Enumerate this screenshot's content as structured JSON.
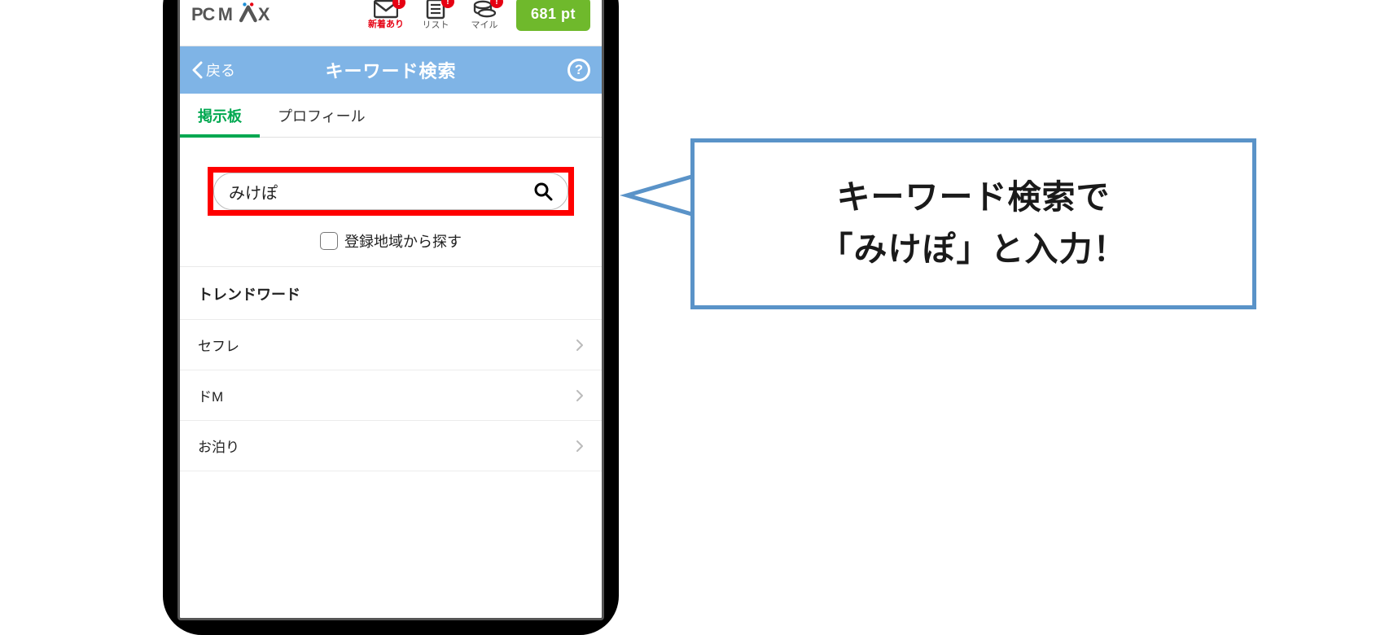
{
  "header": {
    "logo_text": "PCMAX",
    "icons": [
      {
        "name": "mail-icon",
        "label": "新着あり",
        "badge": "!"
      },
      {
        "name": "list-icon",
        "label": "リスト",
        "badge": "!"
      },
      {
        "name": "coins-icon",
        "label": "マイル",
        "badge": "!"
      }
    ],
    "points_button": "681 pt"
  },
  "navbar": {
    "back_label": "戻る",
    "title": "キーワード検索",
    "help_label": "?"
  },
  "tabs": {
    "items": [
      {
        "label": "掲示板",
        "active": true
      },
      {
        "label": "プロフィール",
        "active": false
      }
    ]
  },
  "search": {
    "value": "みけぽ",
    "region_checkbox_label": "登録地域から探す",
    "region_checked": false
  },
  "trend": {
    "header": "トレンドワード",
    "items": [
      {
        "label": "セフレ"
      },
      {
        "label": "ドM"
      },
      {
        "label": "お泊り"
      }
    ]
  },
  "callout": {
    "line1": "キーワード検索で",
    "line2": "「みけぽ」と入力！"
  }
}
